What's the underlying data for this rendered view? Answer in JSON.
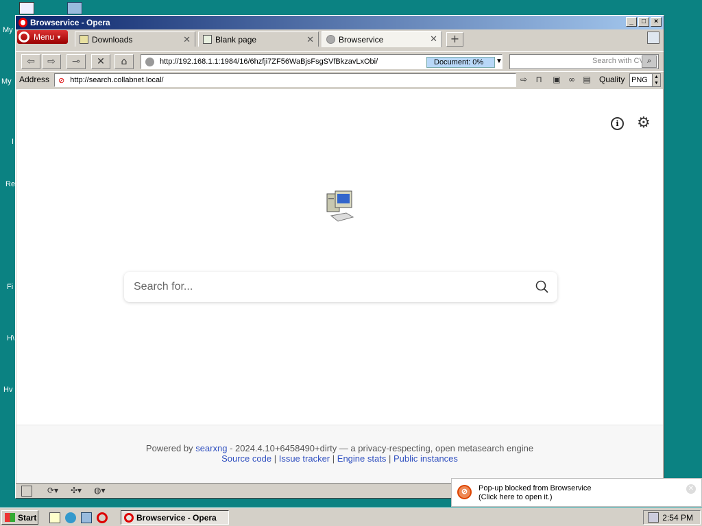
{
  "desktop": {
    "labels": [
      "My",
      "My",
      "I",
      "Re",
      "Fi",
      "H\\",
      "Hv"
    ]
  },
  "window": {
    "title": "Browservice - Opera"
  },
  "tabs": {
    "menu_label": "Menu",
    "items": [
      {
        "label": "Downloads"
      },
      {
        "label": "Blank page"
      },
      {
        "label": "Browservice"
      }
    ]
  },
  "navbar": {
    "url": "http://192.168.1.1:1984/16/6hzfji7ZF56WaBjsFsgSVfBkzavLxObi/",
    "doc_label": "Document:",
    "doc_progress": "0%",
    "search_placeholder": "Search with CV"
  },
  "addressbar": {
    "label": "Address",
    "value": "http://search.collabnet.local/",
    "quality_label": "Quality",
    "quality_value": "PNG"
  },
  "page": {
    "search_placeholder": "Search for...",
    "footer": {
      "powered_by": "Powered by",
      "searxng_link": "searxng",
      "version_text": "- 2024.4.10+6458490+dirty — a privacy-respecting, open metasearch engine",
      "source_code": "Source code",
      "issue_tracker": "Issue tracker",
      "engine_stats": "Engine stats",
      "public_instances": "Public instances",
      "separator": "|"
    }
  },
  "popup": {
    "line1": "Pop-up blocked from Browservice",
    "line2": "(Click here to open it.)"
  },
  "taskbar": {
    "start_label": "Start",
    "task_label": "Browservice - Opera",
    "clock": "2:54 PM"
  }
}
